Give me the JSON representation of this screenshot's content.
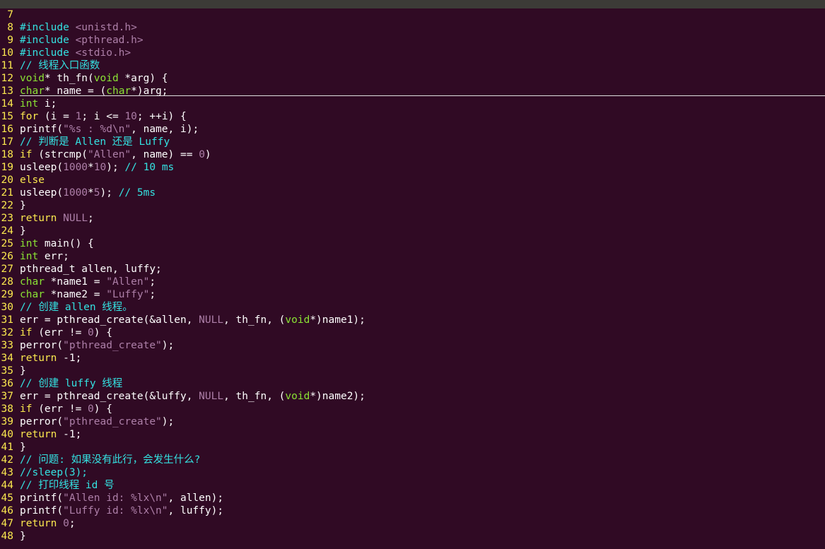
{
  "editor": {
    "lines": [
      {
        "n": "7",
        "tokens": []
      },
      {
        "n": "8",
        "tokens": [
          {
            "t": "#include",
            "c": "pp"
          },
          {
            "t": " <unistd.h>",
            "c": "hdr"
          }
        ]
      },
      {
        "n": "9",
        "tokens": [
          {
            "t": "#include",
            "c": "pp"
          },
          {
            "t": " <pthread.h>",
            "c": "hdr"
          }
        ]
      },
      {
        "n": "10",
        "tokens": [
          {
            "t": "#include",
            "c": "pp"
          },
          {
            "t": " <stdio.h>",
            "c": "hdr"
          }
        ]
      },
      {
        "n": "11",
        "tokens": [
          {
            "t": "// 线程入口函数",
            "c": "c"
          }
        ]
      },
      {
        "n": "12",
        "tokens": [
          {
            "t": "void",
            "c": "ty"
          },
          {
            "t": "* th_fn(",
            "c": "p"
          },
          {
            "t": "void",
            "c": "ty"
          },
          {
            "t": " *arg) {",
            "c": "p"
          }
        ]
      },
      {
        "n": "13",
        "tokens": [
          {
            "t": "char",
            "c": "ty"
          },
          {
            "t": "* name = (",
            "c": "p"
          },
          {
            "t": "char",
            "c": "ty"
          },
          {
            "t": "*)arg;",
            "c": "p"
          }
        ]
      },
      {
        "n": "14",
        "tokens": [
          {
            "t": "int",
            "c": "ty"
          },
          {
            "t": " i;",
            "c": "p"
          }
        ]
      },
      {
        "n": "15",
        "tokens": [
          {
            "t": "for",
            "c": "k"
          },
          {
            "t": " (i = ",
            "c": "p"
          },
          {
            "t": "1",
            "c": "n"
          },
          {
            "t": "; i <= ",
            "c": "p"
          },
          {
            "t": "10",
            "c": "n"
          },
          {
            "t": "; ++i) {",
            "c": "p"
          }
        ]
      },
      {
        "n": "16",
        "tokens": [
          {
            "t": "printf(",
            "c": "p"
          },
          {
            "t": "\"%s : %d\\n\"",
            "c": "s"
          },
          {
            "t": ", name, i);",
            "c": "p"
          }
        ]
      },
      {
        "n": "17",
        "tokens": [
          {
            "t": "// 判断是 Allen 还是 Luffy",
            "c": "c"
          }
        ]
      },
      {
        "n": "18",
        "tokens": [
          {
            "t": "if",
            "c": "k"
          },
          {
            "t": " (strcmp(",
            "c": "p"
          },
          {
            "t": "\"Allen\"",
            "c": "s"
          },
          {
            "t": ", name) == ",
            "c": "p"
          },
          {
            "t": "0",
            "c": "n"
          },
          {
            "t": ")",
            "c": "p"
          }
        ]
      },
      {
        "n": "19",
        "tokens": [
          {
            "t": "usleep(",
            "c": "p"
          },
          {
            "t": "1000",
            "c": "n"
          },
          {
            "t": "*",
            "c": "p"
          },
          {
            "t": "10",
            "c": "n"
          },
          {
            "t": "); ",
            "c": "p"
          },
          {
            "t": "// 10 ms",
            "c": "c"
          }
        ]
      },
      {
        "n": "20",
        "tokens": [
          {
            "t": "else",
            "c": "k"
          }
        ]
      },
      {
        "n": "21",
        "tokens": [
          {
            "t": "usleep(",
            "c": "p"
          },
          {
            "t": "1000",
            "c": "n"
          },
          {
            "t": "*",
            "c": "p"
          },
          {
            "t": "5",
            "c": "n"
          },
          {
            "t": "); ",
            "c": "p"
          },
          {
            "t": "// 5ms",
            "c": "c"
          }
        ]
      },
      {
        "n": "22",
        "tokens": [
          {
            "t": "}",
            "c": "p"
          }
        ]
      },
      {
        "n": "23",
        "tokens": [
          {
            "t": "return",
            "c": "k"
          },
          {
            "t": " ",
            "c": "p"
          },
          {
            "t": "NULL",
            "c": "n"
          },
          {
            "t": ";",
            "c": "p"
          }
        ]
      },
      {
        "n": "24",
        "tokens": [
          {
            "t": "}",
            "c": "p"
          }
        ]
      },
      {
        "n": "25",
        "tokens": [
          {
            "t": "int",
            "c": "ty"
          },
          {
            "t": " main() {",
            "c": "p"
          }
        ]
      },
      {
        "n": "26",
        "tokens": [
          {
            "t": "int",
            "c": "ty"
          },
          {
            "t": " err;",
            "c": "p"
          }
        ]
      },
      {
        "n": "27",
        "tokens": [
          {
            "t": "pthread_t allen, luffy;",
            "c": "p"
          }
        ]
      },
      {
        "n": "28",
        "tokens": [
          {
            "t": "char",
            "c": "ty"
          },
          {
            "t": " *name1 = ",
            "c": "p"
          },
          {
            "t": "\"Allen\"",
            "c": "s"
          },
          {
            "t": ";",
            "c": "p"
          }
        ]
      },
      {
        "n": "29",
        "tokens": [
          {
            "t": "char",
            "c": "ty"
          },
          {
            "t": " *name2 = ",
            "c": "p"
          },
          {
            "t": "\"Luffy\"",
            "c": "s"
          },
          {
            "t": ";",
            "c": "p"
          }
        ]
      },
      {
        "n": "30",
        "tokens": [
          {
            "t": "// 创建 allen 线程。",
            "c": "c"
          }
        ]
      },
      {
        "n": "31",
        "tokens": [
          {
            "t": "err = pthread_create(&allen, ",
            "c": "p"
          },
          {
            "t": "NULL",
            "c": "n"
          },
          {
            "t": ", th_fn, (",
            "c": "p"
          },
          {
            "t": "void",
            "c": "ty"
          },
          {
            "t": "*)name1);",
            "c": "p"
          }
        ]
      },
      {
        "n": "32",
        "tokens": [
          {
            "t": "if",
            "c": "k"
          },
          {
            "t": " (err != ",
            "c": "p"
          },
          {
            "t": "0",
            "c": "n"
          },
          {
            "t": ") {",
            "c": "p"
          }
        ]
      },
      {
        "n": "33",
        "tokens": [
          {
            "t": "perror(",
            "c": "p"
          },
          {
            "t": "\"pthread_create\"",
            "c": "s"
          },
          {
            "t": ");",
            "c": "p"
          }
        ]
      },
      {
        "n": "34",
        "tokens": [
          {
            "t": "return",
            "c": "k"
          },
          {
            "t": " -1;",
            "c": "p"
          }
        ]
      },
      {
        "n": "35",
        "tokens": [
          {
            "t": "}",
            "c": "p"
          }
        ]
      },
      {
        "n": "36",
        "tokens": [
          {
            "t": "// 创建 luffy 线程",
            "c": "c"
          }
        ]
      },
      {
        "n": "37",
        "tokens": [
          {
            "t": "err = pthread_create(&luffy, ",
            "c": "p"
          },
          {
            "t": "NULL",
            "c": "n"
          },
          {
            "t": ", th_fn, (",
            "c": "p"
          },
          {
            "t": "void",
            "c": "ty"
          },
          {
            "t": "*)name2);",
            "c": "p"
          }
        ]
      },
      {
        "n": "38",
        "tokens": [
          {
            "t": "if",
            "c": "k"
          },
          {
            "t": " (err != ",
            "c": "p"
          },
          {
            "t": "0",
            "c": "n"
          },
          {
            "t": ") {",
            "c": "p"
          }
        ]
      },
      {
        "n": "39",
        "tokens": [
          {
            "t": "perror(",
            "c": "p"
          },
          {
            "t": "\"pthread_create\"",
            "c": "s"
          },
          {
            "t": ");",
            "c": "p"
          }
        ]
      },
      {
        "n": "40",
        "tokens": [
          {
            "t": "return",
            "c": "k"
          },
          {
            "t": " -1;",
            "c": "p"
          }
        ]
      },
      {
        "n": "41",
        "tokens": [
          {
            "t": "}",
            "c": "p"
          }
        ]
      },
      {
        "n": "42",
        "tokens": [
          {
            "t": "// 问题: 如果没有此行，会发生什么?",
            "c": "c"
          }
        ]
      },
      {
        "n": "43",
        "tokens": [
          {
            "t": "//sleep(3);",
            "c": "c"
          }
        ]
      },
      {
        "n": "44",
        "tokens": [
          {
            "t": "// 打印线程 id 号",
            "c": "c"
          }
        ]
      },
      {
        "n": "45",
        "tokens": [
          {
            "t": "printf(",
            "c": "p"
          },
          {
            "t": "\"Allen id: %lx\\n\"",
            "c": "s"
          },
          {
            "t": ", allen);",
            "c": "p"
          }
        ]
      },
      {
        "n": "46",
        "tokens": [
          {
            "t": "printf(",
            "c": "p"
          },
          {
            "t": "\"Luffy id: %lx\\n\"",
            "c": "s"
          },
          {
            "t": ", luffy);",
            "c": "p"
          }
        ]
      },
      {
        "n": "47",
        "tokens": [
          {
            "t": "return",
            "c": "k"
          },
          {
            "t": " ",
            "c": "p"
          },
          {
            "t": "0",
            "c": "n"
          },
          {
            "t": ";",
            "c": "p"
          }
        ]
      },
      {
        "n": "48",
        "tokens": [
          {
            "t": "}",
            "c": "p"
          }
        ]
      }
    ]
  },
  "colors": {
    "background": "#300a24",
    "line_number": "#fce94f",
    "keyword": "#fce94f",
    "type": "#8ae234",
    "comment": "#34e2e2",
    "string_number": "#ad7fa8",
    "text": "#ffffff"
  }
}
